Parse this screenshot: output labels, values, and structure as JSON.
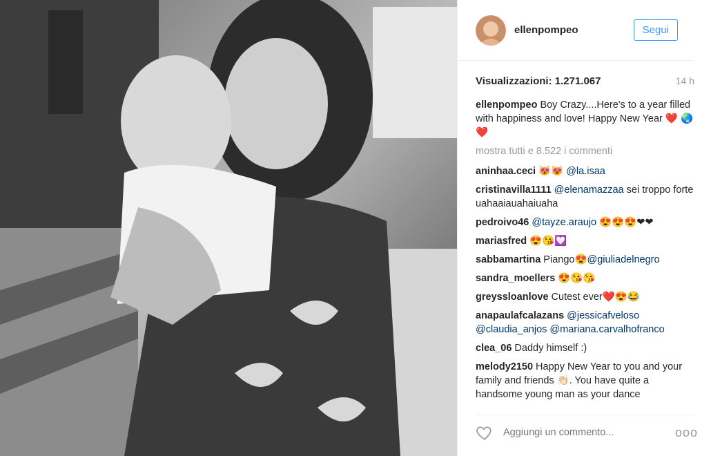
{
  "post": {
    "username": "ellenpompeo",
    "follow_label": "Segui",
    "views_label": "Visualizzazioni: 1.271.067",
    "time_ago": "14 h",
    "caption": {
      "user": "ellenpompeo",
      "text": "Boy Crazy....Here's to a year filled with happiness and love! Happy New Year ❤️ 🌏 ❤️"
    },
    "show_all_comments": "mostra tutti e 8.522 i commenti",
    "comments": [
      {
        "user": "aninhaa.ceci",
        "before": "😻😻",
        "mention": "@la.isaa",
        "after": ""
      },
      {
        "user": "cristinavilla1111",
        "before": "",
        "mention": "@elenamazzaa",
        "after": " sei troppo forte uahaaiauahaiuaha"
      },
      {
        "user": "pedroivo46",
        "before": "",
        "mention": "@tayze.araujo",
        "after": " 😍😍😍❤❤"
      },
      {
        "user": "mariasfred",
        "before": "😍😘💟",
        "mention": "",
        "after": ""
      },
      {
        "user": "sabbamartina",
        "before": "Piango😍",
        "mention": "@giuliadelnegro",
        "after": ""
      },
      {
        "user": "sandra_moellers",
        "before": "😍😘😘",
        "mention": "",
        "after": ""
      },
      {
        "user": "greyssloanlove",
        "before": "Cutest ever❤️😍😂",
        "mention": "",
        "after": ""
      },
      {
        "user": "anapaulafcalazans",
        "before": "",
        "mention": "@jessicafveloso @claudia_anjos @mariana.carvalhofranco",
        "after": ""
      },
      {
        "user": "clea_06",
        "before": "Daddy himself :)",
        "mention": "",
        "after": ""
      },
      {
        "user": "melody2150",
        "before": "Happy New Year to you and your family and friends 👏🏻. You have quite a handsome young man as your dance",
        "mention": "",
        "after": ""
      }
    ],
    "add_comment_placeholder": "Aggiungi un commento...",
    "more_icon_text": "ooo"
  },
  "icons": {
    "like": "heart-icon",
    "more": "more-options-icon"
  },
  "colors": {
    "accent": "#3897f0",
    "mention": "#003569",
    "muted": "#999999"
  }
}
